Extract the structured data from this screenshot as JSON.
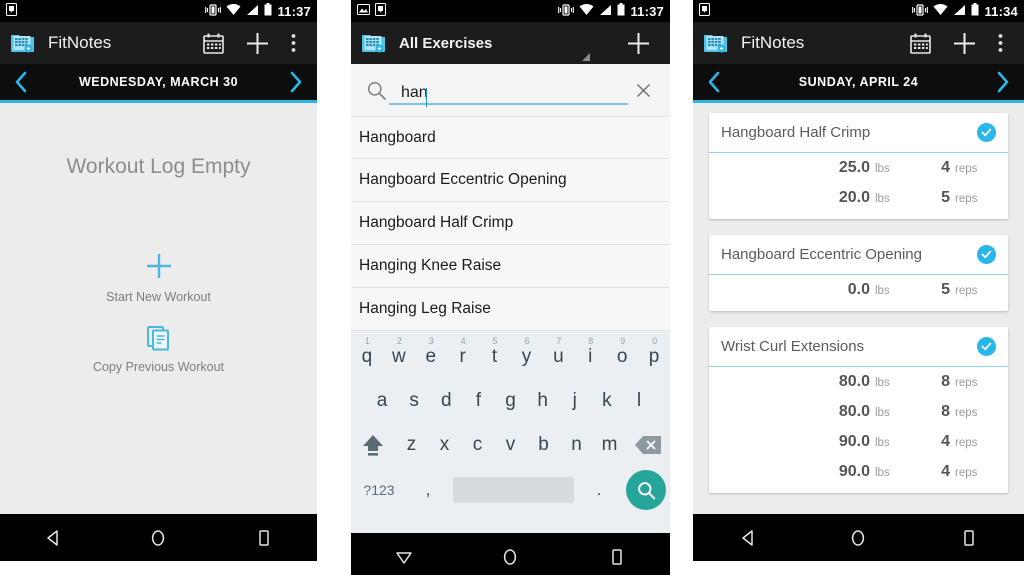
{
  "panels": [
    {
      "status": {
        "time": "11:37",
        "icons": [
          "screenshot-icon",
          "vibrate-icon",
          "wifi-icon",
          "signal-icon",
          "battery-icon"
        ]
      },
      "actionbar": {
        "title": "FitNotes",
        "icons": [
          "calendar-icon",
          "add-icon",
          "overflow-icon"
        ]
      },
      "datebar": {
        "date": "WEDNESDAY, MARCH 30",
        "prev": "chevron-left-icon",
        "next": "chevron-right-icon"
      },
      "empty": {
        "title": "Workout Log Empty",
        "start_label": "Start New Workout",
        "copy_label": "Copy Previous Workout"
      },
      "nav": [
        "back-icon",
        "home-icon",
        "recents-icon"
      ]
    },
    {
      "status": {
        "time": "11:37"
      },
      "actionbar": {
        "title": "All Exercises",
        "icons": [
          "add-icon"
        ]
      },
      "search": {
        "value": "han",
        "placeholder": "Search",
        "clear_label": "×"
      },
      "results": [
        "Hangboard",
        "Hangboard Eccentric Opening",
        "Hangboard Half Crimp",
        "Hanging Knee Raise",
        "Hanging Leg Raise"
      ],
      "keyboard": {
        "row1": [
          {
            "key": "q",
            "num": "1"
          },
          {
            "key": "w",
            "num": "2"
          },
          {
            "key": "e",
            "num": "3"
          },
          {
            "key": "r",
            "num": "4"
          },
          {
            "key": "t",
            "num": "5"
          },
          {
            "key": "y",
            "num": "6"
          },
          {
            "key": "u",
            "num": "7"
          },
          {
            "key": "i",
            "num": "8"
          },
          {
            "key": "o",
            "num": "9"
          },
          {
            "key": "p",
            "num": "0"
          }
        ],
        "row2": [
          "a",
          "s",
          "d",
          "f",
          "g",
          "h",
          "j",
          "k",
          "l"
        ],
        "row3": [
          "z",
          "x",
          "c",
          "v",
          "b",
          "n",
          "m"
        ],
        "shift": "shift-icon",
        "delete": "backspace-icon",
        "symbols": "?123",
        "comma": ",",
        "period": ".",
        "space": "",
        "enter": "search-icon"
      },
      "nav": [
        "keyboard-down-icon",
        "home-icon",
        "recents-icon"
      ]
    },
    {
      "status": {
        "time": "11:34"
      },
      "actionbar": {
        "title": "FitNotes",
        "icons": [
          "calendar-icon",
          "add-icon",
          "overflow-icon"
        ]
      },
      "datebar": {
        "date": "SUNDAY, APRIL 24",
        "prev": "chevron-left-icon",
        "next": "chevron-right-icon"
      },
      "cards": [
        {
          "title": "Hangboard Half Crimp",
          "checked": true,
          "sets": [
            {
              "weight": "25.0",
              "unit": "lbs",
              "reps": "4",
              "reps_unit": "reps"
            },
            {
              "weight": "20.0",
              "unit": "lbs",
              "reps": "5",
              "reps_unit": "reps"
            }
          ]
        },
        {
          "title": "Hangboard Eccentric Opening",
          "checked": true,
          "sets": [
            {
              "weight": "0.0",
              "unit": "lbs",
              "reps": "5",
              "reps_unit": "reps"
            }
          ]
        },
        {
          "title": "Wrist Curl Extensions",
          "checked": true,
          "sets": [
            {
              "weight": "80.0",
              "unit": "lbs",
              "reps": "8",
              "reps_unit": "reps"
            },
            {
              "weight": "80.0",
              "unit": "lbs",
              "reps": "8",
              "reps_unit": "reps"
            },
            {
              "weight": "90.0",
              "unit": "lbs",
              "reps": "4",
              "reps_unit": "reps"
            },
            {
              "weight": "90.0",
              "unit": "lbs",
              "reps": "4",
              "reps_unit": "reps"
            }
          ]
        }
      ],
      "nav": [
        "back-icon",
        "home-icon",
        "recents-icon"
      ]
    }
  ],
  "colors": {
    "accent": "#29b6e8",
    "actionbar": "#1c1c1c",
    "background": "#ececec",
    "enter_key": "#26a69a"
  }
}
